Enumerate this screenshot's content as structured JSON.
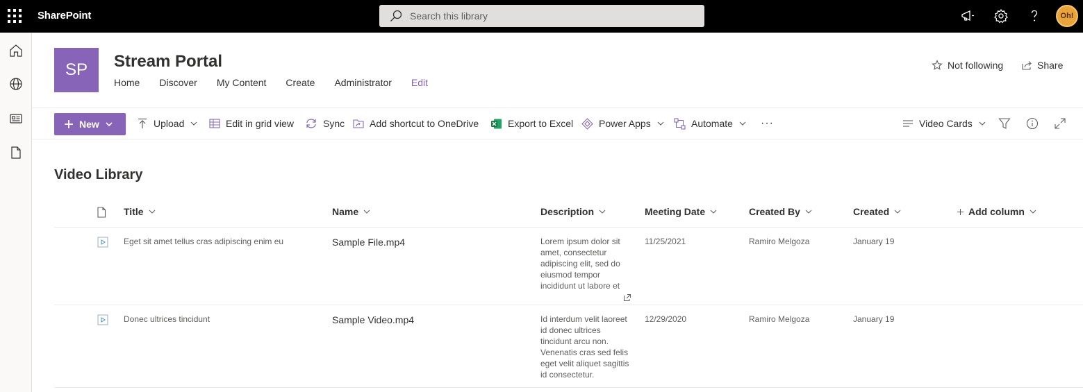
{
  "suite": {
    "brand": "SharePoint",
    "search_placeholder": "Search this library",
    "avatar_text": "Oh!"
  },
  "site": {
    "logo_initials": "SP",
    "title": "Stream Portal",
    "nav": [
      "Home",
      "Discover",
      "My Content",
      "Create",
      "Administrator",
      "Edit"
    ],
    "follow_label": "Not following",
    "share_label": "Share"
  },
  "command_bar": {
    "new_label": "New",
    "upload_label": "Upload",
    "grid_label": "Edit in grid view",
    "sync_label": "Sync",
    "shortcut_label": "Add shortcut to OneDrive",
    "export_label": "Export to Excel",
    "powerapps_label": "Power Apps",
    "automate_label": "Automate",
    "more_label": "···",
    "view_label": "Video Cards"
  },
  "library": {
    "title": "Video Library",
    "columns": {
      "title": "Title",
      "name": "Name",
      "description": "Description",
      "meeting_date": "Meeting Date",
      "created_by": "Created By",
      "created": "Created",
      "add_column": "Add column"
    },
    "rows": [
      {
        "title": "Eget sit amet tellus cras adipiscing enim eu",
        "name": "Sample File.mp4",
        "description": "Lorem ipsum dolor sit amet, consectetur adipiscing elit, sed do eiusmod tempor incididunt ut labore et",
        "meeting_date": "11/25/2021",
        "created_by": "Ramiro Melgoza",
        "created": "January 19"
      },
      {
        "title": "Donec ultrices tincidunt",
        "name": "Sample Video.mp4",
        "description": "Id interdum velit laoreet id donec ultrices tincidunt arcu non. Venenatis cras sed felis eget velit aliquet sagittis id consectetur.",
        "meeting_date": "12/29/2020",
        "created_by": "Ramiro Melgoza",
        "created": "January 19"
      }
    ]
  },
  "colors": {
    "accent": "#8764b8",
    "suitebar": "#000000",
    "excel_green": "#217346"
  }
}
